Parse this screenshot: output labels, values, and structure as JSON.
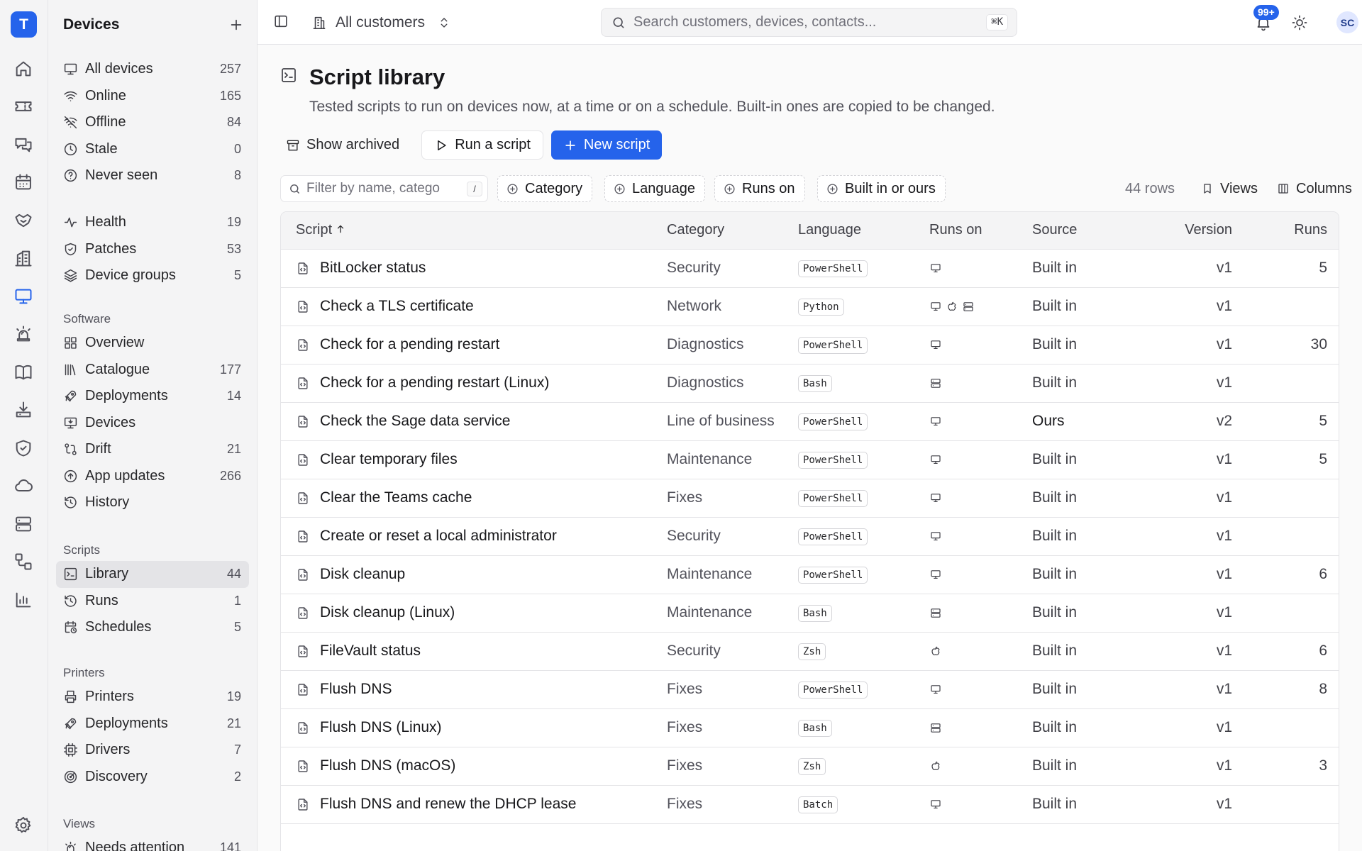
{
  "app": {
    "logo_letter": "T"
  },
  "rail": {
    "items": [
      {
        "name": "home",
        "icon": "home-icon"
      },
      {
        "name": "tickets",
        "icon": "ticket-icon"
      },
      {
        "name": "chat",
        "icon": "chat-icon"
      },
      {
        "name": "calendar",
        "icon": "calendar-icon"
      },
      {
        "name": "contracts",
        "icon": "handshake-icon"
      },
      {
        "name": "customers",
        "icon": "building-icon"
      },
      {
        "name": "devices",
        "icon": "monitor-icon",
        "active": true
      },
      {
        "name": "alerts",
        "icon": "siren-icon"
      },
      {
        "name": "docs",
        "icon": "book-icon"
      },
      {
        "name": "software",
        "icon": "install-icon"
      },
      {
        "name": "security",
        "icon": "shield-icon"
      },
      {
        "name": "cloud",
        "icon": "cloud-icon"
      },
      {
        "name": "servers",
        "icon": "server-icon"
      },
      {
        "name": "workflows",
        "icon": "workflow-icon"
      },
      {
        "name": "reports",
        "icon": "chart-icon"
      },
      {
        "name": "settings",
        "icon": "gear-icon"
      }
    ]
  },
  "sidebar": {
    "title": "Devices",
    "groups": [
      {
        "label": "",
        "items": [
          {
            "label": "All devices",
            "count": "257",
            "icon": "monitor-icon"
          },
          {
            "label": "Online",
            "count": "165",
            "icon": "wifi-icon"
          },
          {
            "label": "Offline",
            "count": "84",
            "icon": "wifi-off-icon"
          },
          {
            "label": "Stale",
            "count": "0",
            "icon": "clock-icon"
          },
          {
            "label": "Never seen",
            "count": "8",
            "icon": "help-circle-icon"
          }
        ]
      },
      {
        "label": "",
        "items": [
          {
            "label": "Health",
            "count": "19",
            "icon": "activity-icon"
          },
          {
            "label": "Patches",
            "count": "53",
            "icon": "shield-check-icon"
          },
          {
            "label": "Device groups",
            "count": "5",
            "icon": "layers-icon"
          }
        ]
      },
      {
        "label": "Software",
        "items": [
          {
            "label": "Overview",
            "count": "",
            "icon": "grid-icon"
          },
          {
            "label": "Catalogue",
            "count": "177",
            "icon": "library-icon"
          },
          {
            "label": "Deployments",
            "count": "14",
            "icon": "rocket-icon"
          },
          {
            "label": "Devices",
            "count": "",
            "icon": "monitor-down-icon"
          },
          {
            "label": "Drift",
            "count": "21",
            "icon": "git-compare-icon"
          },
          {
            "label": "App updates",
            "count": "266",
            "icon": "arrow-up-circle-icon"
          },
          {
            "label": "History",
            "count": "",
            "icon": "history-icon"
          }
        ]
      },
      {
        "label": "Scripts",
        "items": [
          {
            "label": "Library",
            "count": "44",
            "icon": "terminal-square-icon",
            "active": true
          },
          {
            "label": "Runs",
            "count": "1",
            "icon": "history-icon"
          },
          {
            "label": "Schedules",
            "count": "5",
            "icon": "calendar-clock-icon"
          }
        ]
      },
      {
        "label": "Printers",
        "items": [
          {
            "label": "Printers",
            "count": "19",
            "icon": "printer-icon"
          },
          {
            "label": "Deployments",
            "count": "21",
            "icon": "rocket-icon"
          },
          {
            "label": "Drivers",
            "count": "7",
            "icon": "cpu-icon"
          },
          {
            "label": "Discovery",
            "count": "2",
            "icon": "radar-icon"
          }
        ]
      },
      {
        "label": "Views",
        "items": [
          {
            "label": "Needs attention",
            "count": "141",
            "icon": "siren-icon"
          }
        ]
      }
    ]
  },
  "topbar": {
    "customer_scope": "All customers",
    "search_placeholder": "Search customers, devices, contacts...",
    "search_shortcut": "⌘K",
    "notifications_badge": "99+",
    "avatar_initials": "SC"
  },
  "page": {
    "title": "Script library",
    "subtitle": "Tested scripts to run on devices now, at a time or on a schedule. Built-in ones are copied to be changed.",
    "actions": {
      "show_archived": "Show archived",
      "run_script": "Run a script",
      "new_script": "New script"
    },
    "filters": {
      "placeholder": "Filter by name, catego",
      "shortcut": "/",
      "chips": [
        "Category",
        "Language",
        "Runs on",
        "Built in or ours"
      ],
      "row_count": "44 rows",
      "views": "Views",
      "columns": "Columns"
    }
  },
  "table": {
    "columns": {
      "script": "Script",
      "category": "Category",
      "language": "Language",
      "runs_on": "Runs on",
      "source": "Source",
      "version": "Version",
      "runs": "Runs"
    },
    "rows": [
      {
        "name": "BitLocker status",
        "category": "Security",
        "language": "PowerShell",
        "platforms": [
          "windows"
        ],
        "source": "Built in",
        "version": "v1",
        "runs": "5"
      },
      {
        "name": "Check a TLS certificate",
        "category": "Network",
        "language": "Python",
        "platforms": [
          "windows",
          "mac",
          "linux"
        ],
        "source": "Built in",
        "version": "v1",
        "runs": ""
      },
      {
        "name": "Check for a pending restart",
        "category": "Diagnostics",
        "language": "PowerShell",
        "platforms": [
          "windows"
        ],
        "source": "Built in",
        "version": "v1",
        "runs": "30"
      },
      {
        "name": "Check for a pending restart (Linux)",
        "category": "Diagnostics",
        "language": "Bash",
        "platforms": [
          "linux"
        ],
        "source": "Built in",
        "version": "v1",
        "runs": ""
      },
      {
        "name": "Check the Sage data service",
        "category": "Line of business",
        "language": "PowerShell",
        "platforms": [
          "windows"
        ],
        "source": "Ours",
        "version": "v2",
        "runs": "5"
      },
      {
        "name": "Clear temporary files",
        "category": "Maintenance",
        "language": "PowerShell",
        "platforms": [
          "windows"
        ],
        "source": "Built in",
        "version": "v1",
        "runs": "5"
      },
      {
        "name": "Clear the Teams cache",
        "category": "Fixes",
        "language": "PowerShell",
        "platforms": [
          "windows"
        ],
        "source": "Built in",
        "version": "v1",
        "runs": ""
      },
      {
        "name": "Create or reset a local administrator",
        "category": "Security",
        "language": "PowerShell",
        "platforms": [
          "windows"
        ],
        "source": "Built in",
        "version": "v1",
        "runs": ""
      },
      {
        "name": "Disk cleanup",
        "category": "Maintenance",
        "language": "PowerShell",
        "platforms": [
          "windows"
        ],
        "source": "Built in",
        "version": "v1",
        "runs": "6"
      },
      {
        "name": "Disk cleanup (Linux)",
        "category": "Maintenance",
        "language": "Bash",
        "platforms": [
          "linux"
        ],
        "source": "Built in",
        "version": "v1",
        "runs": ""
      },
      {
        "name": "FileVault status",
        "category": "Security",
        "language": "Zsh",
        "platforms": [
          "mac"
        ],
        "source": "Built in",
        "version": "v1",
        "runs": "6"
      },
      {
        "name": "Flush DNS",
        "category": "Fixes",
        "language": "PowerShell",
        "platforms": [
          "windows"
        ],
        "source": "Built in",
        "version": "v1",
        "runs": "8"
      },
      {
        "name": "Flush DNS (Linux)",
        "category": "Fixes",
        "language": "Bash",
        "platforms": [
          "linux"
        ],
        "source": "Built in",
        "version": "v1",
        "runs": ""
      },
      {
        "name": "Flush DNS (macOS)",
        "category": "Fixes",
        "language": "Zsh",
        "platforms": [
          "mac"
        ],
        "source": "Built in",
        "version": "v1",
        "runs": "3"
      },
      {
        "name": "Flush DNS and renew the DHCP lease",
        "category": "Fixes",
        "language": "Batch",
        "platforms": [
          "windows"
        ],
        "source": "Built in",
        "version": "v1",
        "runs": ""
      }
    ]
  },
  "colors": {
    "accent": "#2563eb",
    "sidebar_bg": "#f4f4f5",
    "border": "#e4e4e7"
  }
}
